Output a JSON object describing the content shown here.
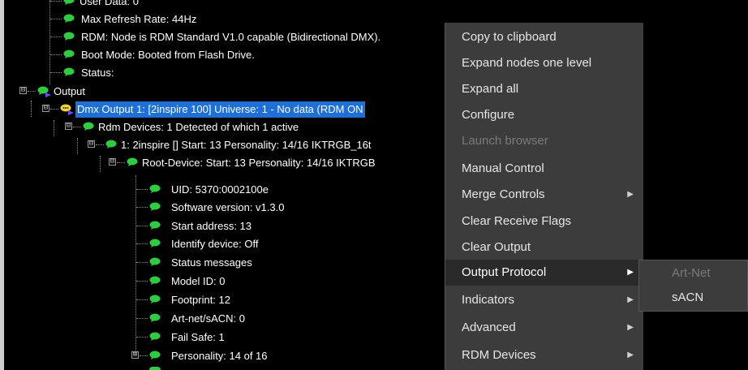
{
  "tree": {
    "rows": [
      {
        "label": "User Data: 0"
      },
      {
        "label": "Max Refresh Rate: 44Hz"
      },
      {
        "label": "RDM: Node is RDM Standard V1.0 capable (Bidirectional DMX)."
      },
      {
        "label": "Boot Mode: Booted from Flash Drive."
      },
      {
        "label": "Status:"
      },
      {
        "label": "Output"
      },
      {
        "label": "Dmx Output 1: [2inspire 100] Universe: 1  - No data (RDM ON"
      },
      {
        "label": "Rdm Devices: 1 Detected of which 1 active"
      },
      {
        "label": "1: 2inspire [] Start: 13 Personality: 14/16 IKTRGB_16t"
      },
      {
        "label": "Root-Device: Start: 13 Personality: 14/16 IKTRGB"
      },
      {
        "label": "UID: 5370:0002100e"
      },
      {
        "label": "Software version: v1.3.0"
      },
      {
        "label": "Start address: 13"
      },
      {
        "label": "Identify device: Off"
      },
      {
        "label": "Status messages"
      },
      {
        "label": "Model ID: 0"
      },
      {
        "label": "Footprint: 12"
      },
      {
        "label": "Art-net/sACN: 0"
      },
      {
        "label": "Fail Safe: 1"
      },
      {
        "label": "Personality: 14 of 16"
      }
    ]
  },
  "context_menu": {
    "items": [
      {
        "label": "Copy to clipboard"
      },
      {
        "label": "Expand nodes one level"
      },
      {
        "label": "Expand all"
      },
      {
        "label": "Configure"
      },
      {
        "label": "Launch browser"
      },
      {
        "label": "Manual Control"
      },
      {
        "label": "Merge Controls",
        "arrow": "▶"
      },
      {
        "label": "Clear Receive Flags"
      },
      {
        "label": "Clear Output"
      },
      {
        "label": "Output Protocol",
        "arrow": "▶"
      },
      {
        "label": "Indicators",
        "arrow": "▶"
      },
      {
        "label": "Advanced",
        "arrow": "▶"
      },
      {
        "label": "RDM Devices",
        "arrow": "▶"
      }
    ]
  },
  "submenu": {
    "items": [
      {
        "label": "Art-Net"
      },
      {
        "label": "sACN"
      }
    ]
  },
  "icons": {
    "expander_minus": "⊟",
    "expander_plus": "⊞"
  },
  "colors": {
    "selection": "#1e6fd8",
    "leaf_green": "#2ecc40",
    "menu_bg": "#3c3c3c"
  }
}
